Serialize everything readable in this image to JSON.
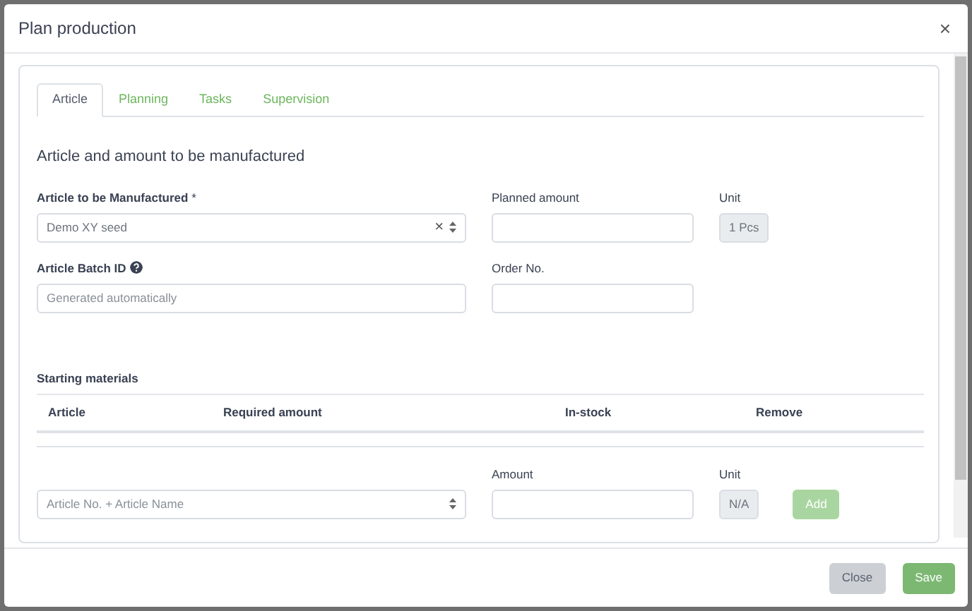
{
  "modal": {
    "title": "Plan production",
    "close_symbol": "×"
  },
  "tabs": [
    {
      "label": "Article",
      "selected": true
    },
    {
      "label": "Planning",
      "selected": false
    },
    {
      "label": "Tasks",
      "selected": false
    },
    {
      "label": "Supervision",
      "selected": false
    }
  ],
  "section_title": "Article and amount to be manufactured",
  "article_field": {
    "label": "Article to be Manufactured",
    "required_mark": "*",
    "value": "Demo XY seed",
    "clear_symbol": "×"
  },
  "planned_amount": {
    "label": "Planned amount"
  },
  "unit": {
    "label": "Unit",
    "value": "1 Pcs"
  },
  "batch_id": {
    "label": "Article Batch ID",
    "placeholder": "Generated automatically"
  },
  "order_no": {
    "label": "Order No."
  },
  "starting_materials": {
    "title": "Starting materials",
    "columns": [
      "Article",
      "Required amount",
      "In-stock",
      "Remove"
    ],
    "article_select": {
      "placeholder": "Article No. + Article Name"
    },
    "amount": {
      "label": "Amount"
    },
    "unit": {
      "label": "Unit",
      "value": "N/A"
    },
    "add_button": {
      "label": "Add",
      "disabled": true
    }
  },
  "footer_buttons": [
    {
      "label": "Close",
      "kind": "secondary"
    },
    {
      "label": "Save",
      "kind": "primary"
    }
  ]
}
